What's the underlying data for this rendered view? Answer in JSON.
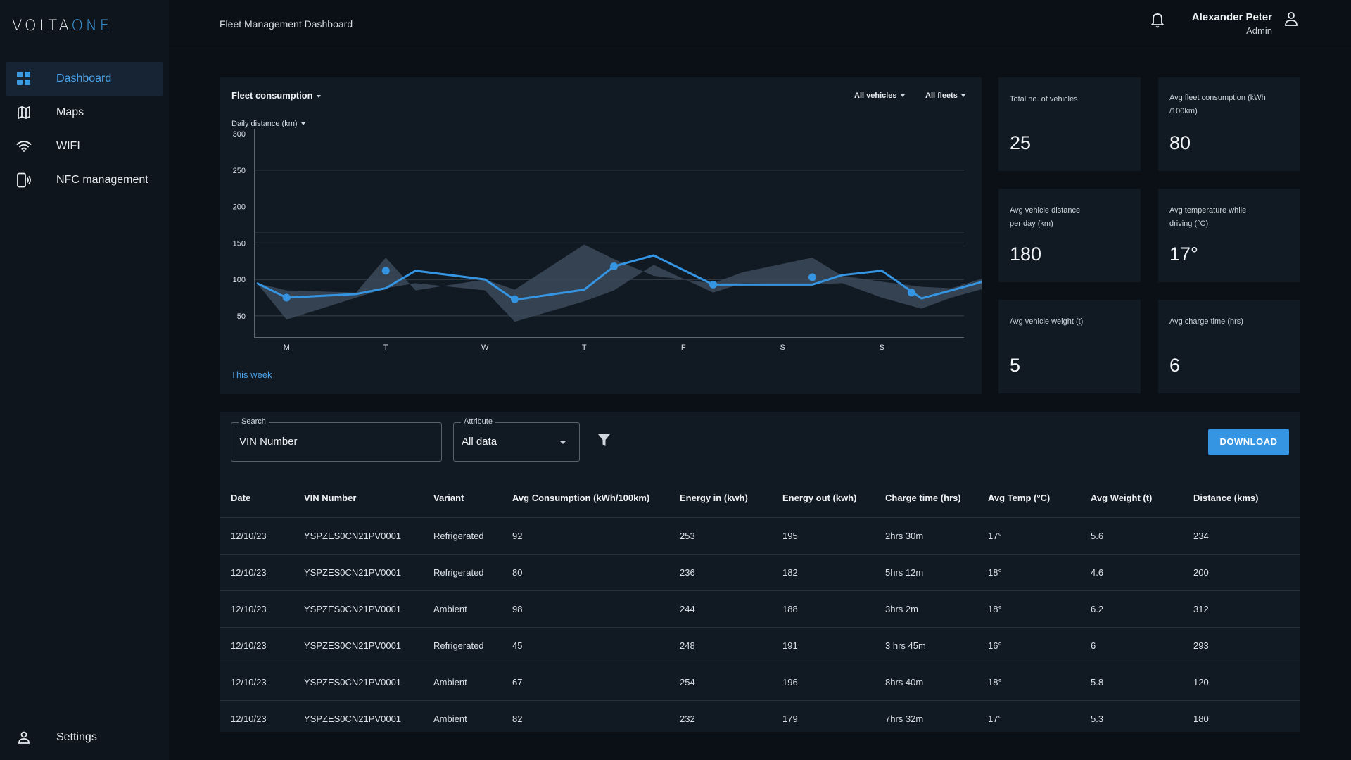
{
  "brand": {
    "name_left": "VOLTA",
    "name_right": "ONE"
  },
  "sidebar": {
    "items": [
      {
        "label": "Dashboard",
        "icon": "grid-icon",
        "active": true
      },
      {
        "label": "Maps",
        "icon": "map-icon",
        "active": false
      },
      {
        "label": "WIFI",
        "icon": "wifi-icon",
        "active": false
      },
      {
        "label": "NFC management",
        "icon": "nfc-icon",
        "active": false
      }
    ],
    "settings": {
      "label": "Settings",
      "icon": "user-icon"
    }
  },
  "header": {
    "title": "Fleet Management Dashboard",
    "user_name": "Alexander Peter",
    "user_role": "Admin"
  },
  "chart_panel": {
    "metric_label": "Fleet consumption",
    "series_label": "Daily distance (km)",
    "filter_vehicles": "All vehicles",
    "filter_fleets": "All fleets",
    "period_link": "This week"
  },
  "chart_data": {
    "type": "line",
    "xlabel": "",
    "ylabel": "",
    "ylim": [
      20,
      300
    ],
    "yticks": [
      300,
      250,
      200,
      150,
      100,
      50
    ],
    "categories": [
      "M",
      "T",
      "W",
      "T",
      "F",
      "S",
      "S"
    ],
    "series": [
      {
        "values": [
          95,
          75,
          80,
          88,
          112,
          100,
          72,
          86,
          118,
          133,
          93,
          93,
          93,
          106,
          112,
          74,
          85,
          100
        ],
        "x": [
          0,
          0.3,
          1.0,
          1.3,
          1.6,
          2.3,
          2.6,
          3.3,
          3.6,
          4.0,
          4.6,
          4.9,
          5.6,
          5.9,
          6.3,
          6.7,
          7.0,
          7.4
        ]
      }
    ],
    "markers": [
      {
        "x": 0.3,
        "y": 75
      },
      {
        "x": 1.3,
        "y": 112
      },
      {
        "x": 2.6,
        "y": 73
      },
      {
        "x": 3.6,
        "y": 118
      },
      {
        "x": 4.6,
        "y": 93
      },
      {
        "x": 5.6,
        "y": 103
      },
      {
        "x": 6.6,
        "y": 82
      }
    ],
    "band_upper": [
      95,
      85,
      82,
      130,
      85,
      100,
      86,
      148,
      128,
      105,
      95,
      110,
      130,
      105,
      97,
      90,
      88,
      105
    ],
    "band_lower": [
      95,
      45,
      75,
      88,
      95,
      85,
      42,
      70,
      85,
      120,
      82,
      95,
      93,
      95,
      75,
      60,
      75,
      90
    ],
    "gridlines": [
      250,
      165,
      150,
      100,
      100,
      50
    ],
    "accent": "#3595e2",
    "band_color": "#3b4a59"
  },
  "stats": [
    {
      "label": "Total no. of vehicles",
      "value": "25"
    },
    {
      "label": "Avg fleet consumption (kWh /100km)",
      "value": "80"
    },
    {
      "label": "Avg vehicle distance per day (km)",
      "value": "180"
    },
    {
      "label": "Avg temperature while driving (°C)",
      "value": "17°"
    },
    {
      "label": "Avg vehicle weight (t)",
      "value": "5"
    },
    {
      "label": "Avg charge time (hrs)",
      "value": "6"
    }
  ],
  "toolbar": {
    "search_label": "Search",
    "search_value": "VIN Number",
    "attribute_label": "Attribute",
    "attribute_value": "All data",
    "download_label": "DOWNLOAD"
  },
  "table": {
    "columns": [
      "Date",
      "VIN Number",
      "Variant",
      "Avg Consumption (kWh/100km)",
      "Energy in (kwh)",
      "Energy out (kwh)",
      "Charge time (hrs)",
      "Avg Temp (°C)",
      "Avg Weight (t)",
      "Distance (kms)"
    ],
    "rows": [
      [
        "12/10/23",
        "YSPZES0CN21PV0001",
        "Refrigerated",
        "92",
        "253",
        "195",
        "2hrs 30m",
        "17°",
        "5.6",
        "234"
      ],
      [
        "12/10/23",
        "YSPZES0CN21PV0001",
        "Refrigerated",
        "80",
        "236",
        "182",
        "5hrs 12m",
        "18°",
        "4.6",
        "200"
      ],
      [
        "12/10/23",
        "YSPZES0CN21PV0001",
        "Ambient",
        "98",
        "244",
        "188",
        "3hrs 2m",
        "18°",
        "6.2",
        "312"
      ],
      [
        "12/10/23",
        "YSPZES0CN21PV0001",
        "Refrigerated",
        "45",
        "248",
        "191",
        "3 hrs 45m",
        "16°",
        "6",
        "293"
      ],
      [
        "12/10/23",
        "YSPZES0CN21PV0001",
        "Ambient",
        "67",
        "254",
        "196",
        "8hrs 40m",
        "18°",
        "5.8",
        "120"
      ],
      [
        "12/10/23",
        "YSPZES0CN21PV0001",
        "Ambient",
        "82",
        "232",
        "179",
        "7hrs 32m",
        "17°",
        "5.3",
        "180"
      ]
    ]
  }
}
